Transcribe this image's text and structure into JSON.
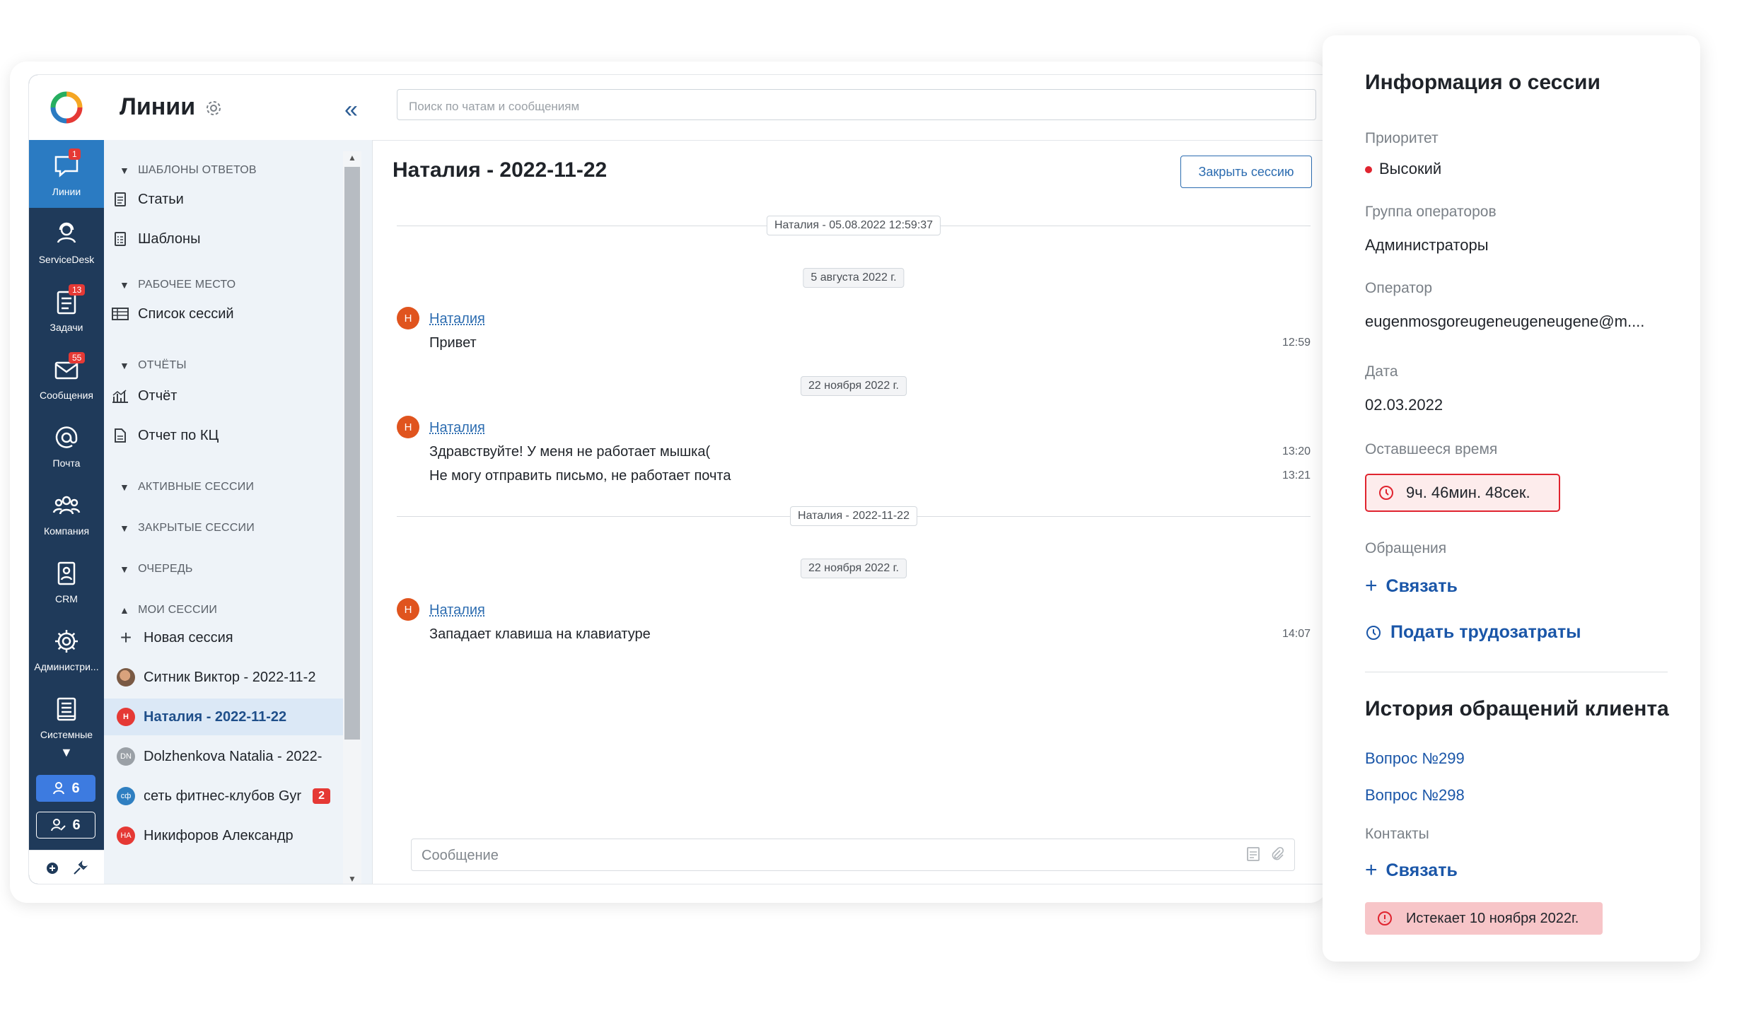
{
  "nav": {
    "items": [
      {
        "label": "Линии",
        "icon": "chat-icon",
        "badge": "1"
      },
      {
        "label": "ServiceDesk",
        "icon": "helpdesk-icon",
        "badge": ""
      },
      {
        "label": "Задачи",
        "icon": "tasks-icon",
        "badge": "13"
      },
      {
        "label": "Сообщения",
        "icon": "mail-icon",
        "badge": "55"
      },
      {
        "label": "Почта",
        "icon": "at-icon",
        "badge": ""
      },
      {
        "label": "Компания",
        "icon": "people-icon",
        "badge": ""
      },
      {
        "label": "CRM",
        "icon": "crm-icon",
        "badge": ""
      },
      {
        "label": "Администри...",
        "icon": "gear-icon",
        "badge": ""
      },
      {
        "label": "Системные",
        "icon": "book-icon",
        "badge": ""
      }
    ],
    "pill_online": "6",
    "pill_busy": "6"
  },
  "sidebar": {
    "title": "Линии",
    "sections": {
      "templates": "Шаблоны ответов",
      "workplace": "Рабочее место",
      "reports": "Отчёты",
      "active": "Активные сессии",
      "closed": "Закрытые сессии",
      "queue": "Очередь",
      "mine": "Мои сессии"
    },
    "items": {
      "articles": "Статьи",
      "templates": "Шаблоны",
      "sessions_list": "Список сессий",
      "report": "Отчёт",
      "report_kc": "Отчет по КЦ",
      "new_session": "Новая сессия"
    },
    "sessions": [
      {
        "name": "Ситник Виктор - 2022-11-2",
        "avatar": "",
        "count": ""
      },
      {
        "name": "Наталия - 2022-11-22",
        "avatar": "Н",
        "count": ""
      },
      {
        "name": "Dolzhenkova Natalia - 2022-",
        "avatar": "DN",
        "count": ""
      },
      {
        "name": "сеть фитнес-клубов Gyr",
        "avatar": "сф",
        "count": "2"
      },
      {
        "name": "Никифоров Александр",
        "avatar": "НА",
        "count": ""
      }
    ]
  },
  "chat": {
    "search_placeholder": "Поиск по чатам и сообщениям",
    "title": "Наталия - 2022-11-22",
    "close_button": "Закрыть сессию",
    "session_divider_1": "Наталия - 05.08.2022 12:59:37",
    "date_1": "5 августа 2022 г.",
    "author": "Наталия",
    "avatar_letter": "Н",
    "msg_1": "Привет",
    "time_1": "12:59",
    "date_2": "22 ноября 2022 г.",
    "msg_2": "Здравствуйте! У меня не работает мышка(",
    "time_2": "13:20",
    "msg_3": "Не могу отправить письмо, не работает почта",
    "time_3": "13:21",
    "session_divider_2": "Наталия - 2022-11-22",
    "date_3": "22 ноября 2022 г.",
    "msg_4": "Западает клавиша на клавиатуре",
    "time_4": "14:07",
    "composer_placeholder": "Сообщение"
  },
  "panel": {
    "title": "Информация о сессии",
    "priority_label": "Приоритет",
    "priority_value": "Высокий",
    "group_label": "Группа операторов",
    "group_value": "Администраторы",
    "operator_label": "Оператор",
    "operator_value": "eugenmosgoreugeneugeneugene@m....",
    "date_label": "Дата",
    "date_value": "02.03.2022",
    "remaining_label": "Оставшееся время",
    "remaining_value": "9ч. 46мин. 48сек.",
    "requests_label": "Обращения",
    "link_action": "Связать",
    "worklog_action": "Подать трудозатраты",
    "history_title": "История обращений клиента",
    "history": [
      "Вопрос №299",
      "Вопрос №298"
    ],
    "contacts_label": "Контакты",
    "contacts_action": "Связать",
    "expire_text": "Истекает 10 ноября 2022г.",
    "colors": {
      "link": "#1a56a8",
      "danger": "#e0242f",
      "nav": "#1f3a5a",
      "nav_active": "#2b7bc2"
    }
  }
}
